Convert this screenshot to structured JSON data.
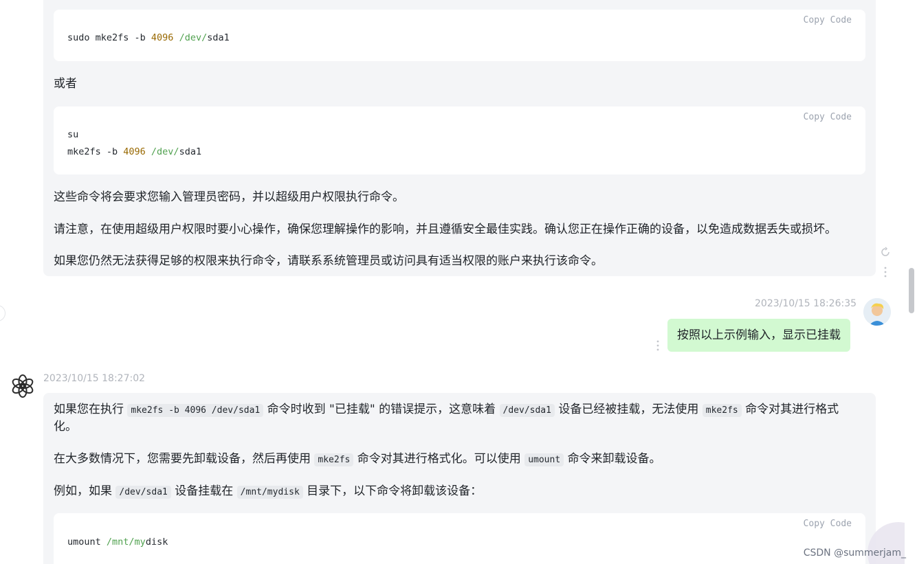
{
  "assistant_prev": {
    "code1": {
      "copy_label": "Copy Code",
      "line1_a": "sudo mke2fs -b ",
      "line1_num": "4096",
      "line1_path": " /dev/",
      "line1_end": "sda1"
    },
    "or_text": "或者",
    "code2": {
      "copy_label": "Copy Code",
      "line1": "su",
      "line2_a": "mke2fs -b ",
      "line2_num": "4096",
      "line2_path": " /dev/",
      "line2_end": "sda1"
    },
    "p1": "这些命令将会要求您输入管理员密码，并以超级用户权限执行命令。",
    "p2": "请注意，在使用超级用户权限时要小心操作，确保您理解操作的影响，并且遵循安全最佳实践。确认您正在操作正确的设备，以免造成数据丢失或损坏。",
    "p3": "如果您仍然无法获得足够的权限来执行命令，请联系系统管理员或访问具有适当权限的账户来执行该命令。"
  },
  "user_msg": {
    "timestamp": "2023/10/15 18:26:35",
    "text": "按照以上示例输入，显示已挂载"
  },
  "assistant_msg": {
    "timestamp": "2023/10/15 18:27:02",
    "p1_a": "如果您在执行",
    "p1_code1": "mke2fs -b 4096 /dev/sda1",
    "p1_b": "命令时收到 \"已挂载\" 的错误提示，这意味着",
    "p1_code2": "/dev/sda1",
    "p1_c": "设备已经被挂载，无法使用",
    "p1_code3": "mke2fs",
    "p1_d": "命令对其进行格式",
    "p1_e": "化。",
    "p2_a": "在大多数情况下，您需要先卸载设备，然后再使用",
    "p2_code1": "mke2fs",
    "p2_b": "命令对其进行格式化。可以使用",
    "p2_code2": "umount",
    "p2_c": "命令来卸载设备。",
    "p3_a": "例如，如果",
    "p3_code1": "/dev/sda1",
    "p3_b": "设备挂载在",
    "p3_code2": "/mnt/mydisk",
    "p3_c": "目录下，以下命令将卸载该设备：",
    "code3": {
      "copy_label": "Copy Code",
      "line1_a": "umount ",
      "line1_path": "/mnt/my",
      "line1_end": "disk"
    }
  },
  "watermark": "CSDN @summerjam_"
}
